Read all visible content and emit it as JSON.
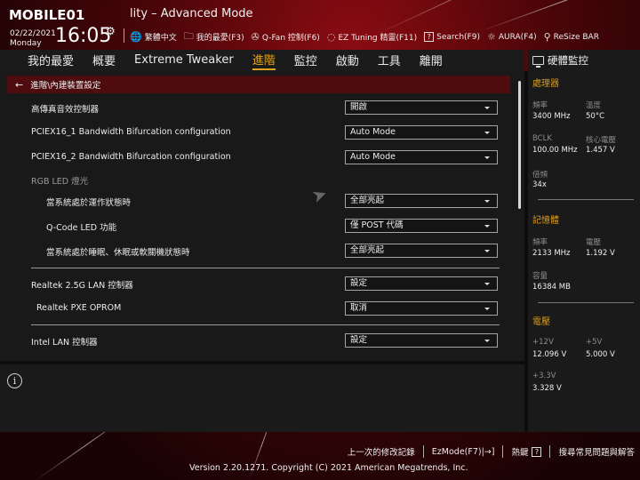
{
  "header": {
    "logo_text": "MOBILE01",
    "title": "lity – Advanced Mode",
    "date": "02/22/2021",
    "weekday": "Monday",
    "time": "16:05",
    "toolbar": [
      {
        "icon": "globe-icon",
        "glyph": "🌐",
        "label": "繁體中文"
      },
      {
        "icon": "favorites-folder-icon",
        "glyph": "🗀",
        "label": "我的最愛(F3)"
      },
      {
        "icon": "fan-icon",
        "glyph": "✇",
        "label": "Q-Fan 控制(F6)"
      },
      {
        "icon": "lightbulb-icon",
        "glyph": "💡",
        "label": "EZ Tuning 精靈(F11)"
      },
      {
        "icon": "question-box-icon",
        "glyph": "?",
        "label": "Search(F9)"
      },
      {
        "icon": "aura-light-icon",
        "glyph": "☼",
        "label": "AURA(F4)"
      },
      {
        "icon": "resize-bar-icon",
        "glyph": "⚲",
        "label": "ReSize BAR"
      }
    ]
  },
  "nav": {
    "tabs": [
      {
        "label": "我的最愛",
        "active": false
      },
      {
        "label": "概要",
        "active": false
      },
      {
        "label": "Extreme Tweaker",
        "active": false
      },
      {
        "label": "進階",
        "active": true
      },
      {
        "label": "監控",
        "active": false
      },
      {
        "label": "啟動",
        "active": false
      },
      {
        "label": "工具",
        "active": false
      },
      {
        "label": "離開",
        "active": false
      }
    ]
  },
  "breadcrumb": {
    "back_glyph": "←",
    "path": "進階\\內建裝置設定"
  },
  "settings": [
    {
      "label": "高傳真音效控制器",
      "value": "開啟"
    },
    {
      "label": "PCIEX16_1 Bandwidth Bifurcation configuration",
      "value": "Auto Mode"
    },
    {
      "label": "PCIEX16_2 Bandwidth Bifurcation configuration",
      "value": "Auto Mode"
    },
    {
      "label": "RGB LED 燈光",
      "value": null
    },
    {
      "label": "當系統處於運作狀態時",
      "value": "全部亮起"
    },
    {
      "label": "Q-Code LED 功能",
      "value": "僅 POST 代碼"
    },
    {
      "label": "當系統處於睡眠、休眠或軟關機狀態時",
      "value": "全部亮起"
    },
    {
      "label": "Realtek 2.5G LAN 控制器",
      "value": "設定"
    },
    {
      "label": "Realtek PXE OPROM",
      "value": "取消"
    },
    {
      "label": "Intel LAN 控制器",
      "value": "設定"
    }
  ],
  "help": {
    "icon_glyph": "i"
  },
  "hardware_monitor": {
    "title": "硬體監控",
    "cpu": {
      "title": "處理器",
      "freq_label": "頻率",
      "freq": "3400 MHz",
      "temp_label": "溫度",
      "temp": "50°C",
      "bclk_label": "BCLK",
      "bclk": "100.00 MHz",
      "vcore_label": "核心電壓",
      "vcore": "1.457 V",
      "ratio_label": "倍頻",
      "ratio": "34x"
    },
    "memory": {
      "title": "記憶體",
      "freq_label": "頻率",
      "freq": "2133 MHz",
      "volt_label": "電壓",
      "volt": "1.192 V",
      "cap_label": "容量",
      "cap": "16384 MB"
    },
    "voltage": {
      "title": "電壓",
      "v12_label": "+12V",
      "v12": "12.096 V",
      "v5_label": "+5V",
      "v5": "5.000 V",
      "v33_label": "+3.3V",
      "v33": "3.328 V"
    }
  },
  "footer": {
    "last_modified": "上一次的修改記錄",
    "ezmode": "EzMode(F7)|→]",
    "hotkeys": "熱鍵",
    "hotkeys_glyph": "?",
    "faq": "搜尋常見問題與解答",
    "version": "Version 2.20.1271. Copyright (C) 2021 American Megatrends, Inc."
  }
}
